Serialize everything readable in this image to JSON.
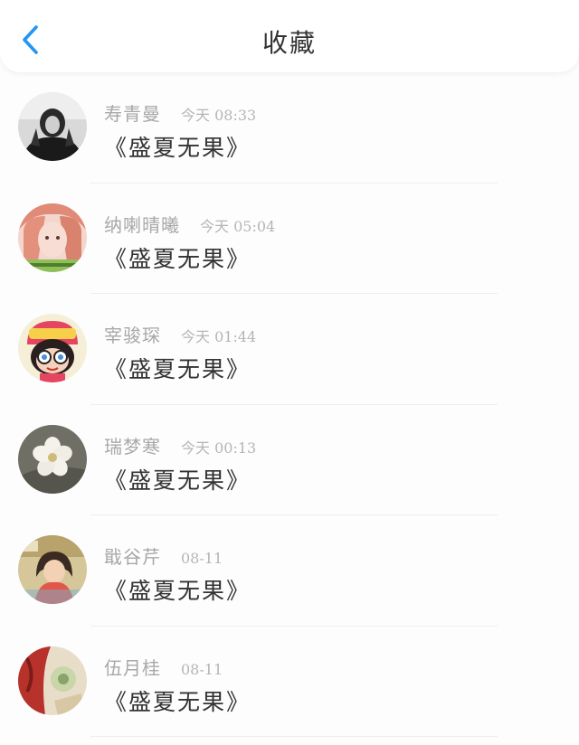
{
  "header": {
    "title": "收藏"
  },
  "colors": {
    "accent": "#2196f3",
    "name_text": "#a8a8a8",
    "content_text": "#333333"
  },
  "favorites": [
    {
      "name": "寿青曼",
      "time": "今天 08:33",
      "content": "《盛夏无果》",
      "avatar_icon": "avatar-person-dark"
    },
    {
      "name": "纳喇晴曦",
      "time": "今天 05:04",
      "content": "《盛夏无果》",
      "avatar_icon": "avatar-girl-pink-hair"
    },
    {
      "name": "宰骏琛",
      "time": "今天 01:44",
      "content": "《盛夏无果》",
      "avatar_icon": "avatar-cartoon-arale"
    },
    {
      "name": "瑞梦寒",
      "time": "今天 00:13",
      "content": "《盛夏无果》",
      "avatar_icon": "avatar-white-flower"
    },
    {
      "name": "戢谷芹",
      "time": "08-11",
      "content": "《盛夏无果》",
      "avatar_icon": "avatar-anime-girl"
    },
    {
      "name": "伍月桂",
      "time": "08-11",
      "content": "《盛夏无果》",
      "avatar_icon": "avatar-red-illustration"
    }
  ]
}
